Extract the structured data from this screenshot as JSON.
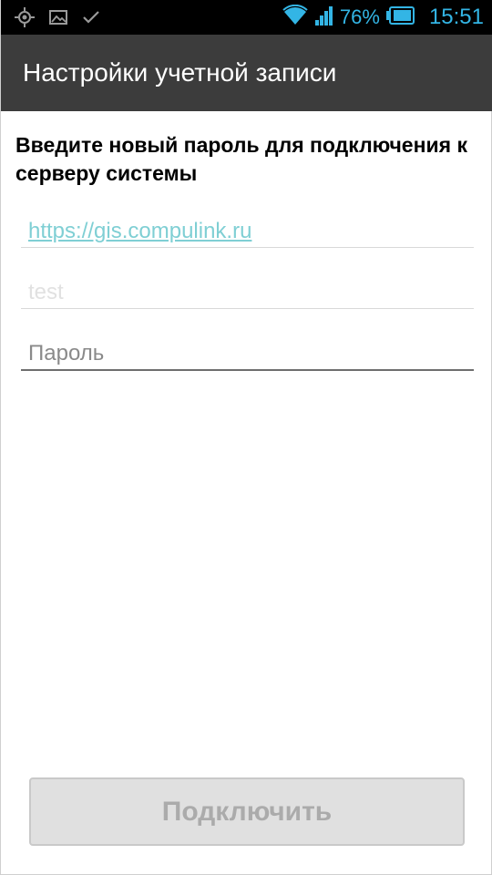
{
  "status_bar": {
    "icons_left": [
      "gps-icon",
      "image-icon",
      "checkmark-icon"
    ],
    "battery_percent": "76%",
    "time": "15:51",
    "accent_color": "#33b5e5"
  },
  "action_bar": {
    "title": "Настройки учетной записи"
  },
  "form": {
    "prompt": "Введите новый пароль для подключения к серверу системы",
    "url_value": "https://gis.compulink.ru",
    "login_value": "test",
    "password_placeholder": "Пароль"
  },
  "connect_button": {
    "label": "Подключить",
    "enabled": false
  }
}
